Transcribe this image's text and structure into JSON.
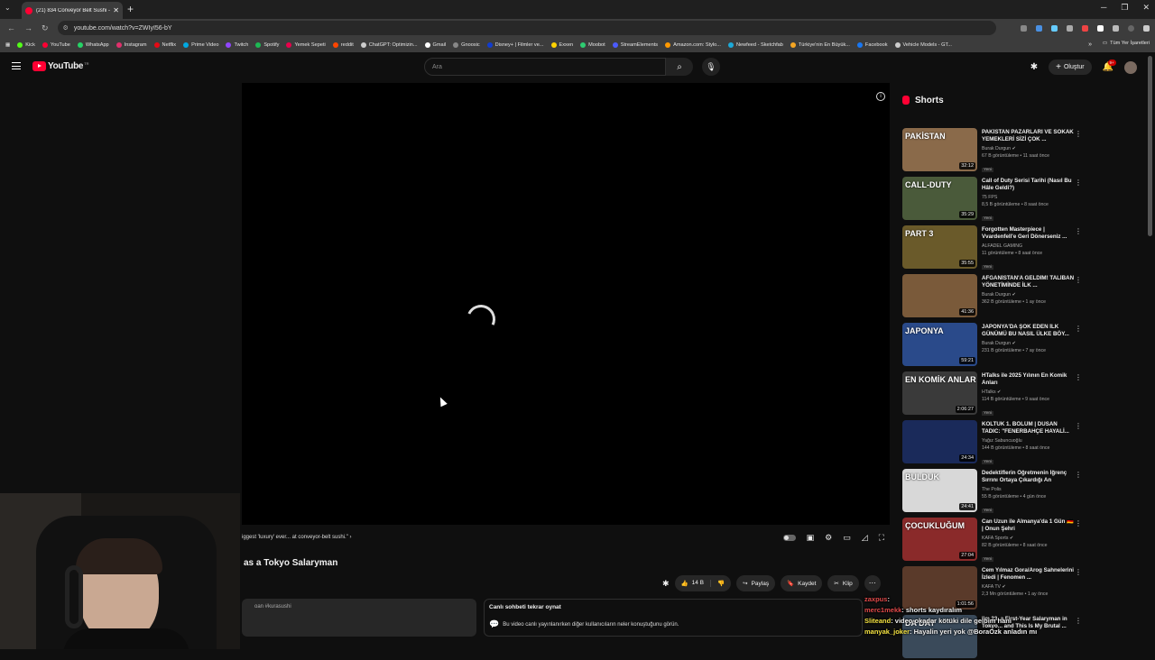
{
  "browser": {
    "tab_title": "(21) 834 Conveyor Belt Sushi -",
    "url": "youtube.com/watch?v=ZWIyI56-bY",
    "bookmarks": [
      {
        "label": "Kick",
        "color": "#53fc18"
      },
      {
        "label": "YouTube",
        "color": "#ff0033"
      },
      {
        "label": "WhatsApp",
        "color": "#25d366"
      },
      {
        "label": "Instagram",
        "color": "#e1306c"
      },
      {
        "label": "Netflix",
        "color": "#e50914"
      },
      {
        "label": "Prime Video",
        "color": "#00a8e1"
      },
      {
        "label": "Twitch",
        "color": "#9146ff"
      },
      {
        "label": "Spotify",
        "color": "#1db954"
      },
      {
        "label": "Yemek Sepeti",
        "color": "#ea004b"
      },
      {
        "label": "reddit",
        "color": "#ff4500"
      },
      {
        "label": "ChatGPT: Optimizin...",
        "color": "#cccccc"
      },
      {
        "label": "Gmail",
        "color": "#ffffff"
      },
      {
        "label": "Gnoosic",
        "color": "#888888"
      },
      {
        "label": "Disney+ | Filmler ve...",
        "color": "#113ccf"
      },
      {
        "label": "Exxen",
        "color": "#ffd200"
      },
      {
        "label": "Moobot",
        "color": "#2ecc71"
      },
      {
        "label": "StreamElements",
        "color": "#4b5bff"
      },
      {
        "label": "Amazon.com: Stylo...",
        "color": "#ff9900"
      },
      {
        "label": "Newfeed - Sketchfab",
        "color": "#1caad9"
      },
      {
        "label": "Türkiye'nin En Büyük...",
        "color": "#f5a623"
      },
      {
        "label": "Facebook",
        "color": "#1877f2"
      },
      {
        "label": "Vehicle Models - GT...",
        "color": "#cccccc"
      }
    ],
    "bookmarks_more": "»",
    "all_bookmarks": "Tüm Yer İşaretleri"
  },
  "youtube": {
    "logo_text": "YouTube",
    "country_code": "TR",
    "search_placeholder": "Ara",
    "create_label": "Oluştur",
    "notifications_count": "9+"
  },
  "player": {
    "chapter_title": "iggest 'luxury' ever... at conveyor-belt sushi.\"",
    "chapter_arrow": "›"
  },
  "video": {
    "title": "as a Tokyo Salaryman",
    "likes": "14 B",
    "share_label": "Paylaş",
    "save_label": "Kaydet",
    "clip_label": "Klip",
    "description_snippet": "oan #kurasushi"
  },
  "live_chat": {
    "header": "Canlı sohbeti tekrar oynat",
    "subtitle": "Bu video canlı yayınlanırken diğer kullanıcıların neler konuştuğunu görün."
  },
  "sidebar": {
    "shorts_label": "Shorts",
    "recommendations": [
      {
        "title": "PAKİSTAN PAZARLARI VE SOKAK YEMEKLERİ SİZİ ÇOK ...",
        "channel": "Burak Durgun",
        "verified": true,
        "meta": "67 B görüntüleme • 11 saat önce",
        "new": "Yeni",
        "duration": "32:12",
        "thumb_text": "PAKİSTAN",
        "thumb_color": "#8a6a4a"
      },
      {
        "title": "Call of Duty Serisi Tarihi (Nasıl Bu Hâle Geldi?)",
        "channel": "75 FPS",
        "verified": false,
        "meta": "8,5 B görüntüleme • 8 saat önce",
        "new": "Yeni",
        "duration": "35:29",
        "thumb_text": "CALL-DUTY",
        "thumb_color": "#4a5a3a"
      },
      {
        "title": "Forgotten Masterpiece | Vvardenfell'e Geri Dönerseniz ...",
        "channel": "ALFADEL GAMING",
        "verified": false,
        "meta": "11 görüntüleme • 8 saat önce",
        "new": "Yeni",
        "duration": "35:55",
        "thumb_text": "PART 3",
        "thumb_color": "#6a5a2a"
      },
      {
        "title": "AFGANİSTAN'A GELDİM! TALİBAN YÖNETİMİNDE İLK ...",
        "channel": "Burak Durgun",
        "verified": true,
        "meta": "362 B görüntüleme • 1 ay önce",
        "new": "",
        "duration": "41:36",
        "thumb_text": "",
        "thumb_color": "#7a5a3a"
      },
      {
        "title": "JAPONYA'DA ŞOK EDEN İLK GÜNÜMÜ BU NASIL ÜLKE BÖY...",
        "channel": "Burak Durgun",
        "verified": true,
        "meta": "231 B görüntüleme • 7 ay önce",
        "new": "",
        "duration": "59:21",
        "thumb_text": "JAPONYA",
        "thumb_color": "#2a4a8a"
      },
      {
        "title": "HTalks ile 2025 Yılının En Komik Anları",
        "channel": "HTalks",
        "verified": true,
        "meta": "114 B görüntüleme • 9 saat önce",
        "new": "Yeni",
        "duration": "2:06:27",
        "thumb_text": "EN KOMİK ANLAR",
        "thumb_color": "#3a3a3a"
      },
      {
        "title": "KOLTUK 1. BÖLÜM | DUSAN TADIC: \"FENERBAHÇE HAYALİ...",
        "channel": "Yağız Sabuncuoğlu",
        "verified": false,
        "meta": "144 B görüntüleme • 8 saat önce",
        "new": "Yeni",
        "duration": "24:34",
        "thumb_text": "",
        "thumb_color": "#1a2a5a"
      },
      {
        "title": "Dedektiflerin Öğretmenin İğrenç Sırrını Ortaya Çıkardığı An",
        "channel": "The Polis",
        "verified": false,
        "meta": "55 B görüntüleme • 4 gün önce",
        "new": "Yeni",
        "duration": "24:41",
        "thumb_text": "BULDUK",
        "thumb_color": "#d8d8d8"
      },
      {
        "title": "Can Uzun ile Almanya'da 1 Gün 🇩🇪 | Onun Şehri",
        "channel": "KAFA Sports",
        "verified": true,
        "meta": "82 B görüntüleme • 8 saat önce",
        "new": "Yeni",
        "duration": "27:04",
        "thumb_text": "ÇOCUKLUĞUM",
        "thumb_color": "#8a2a2a"
      },
      {
        "title": "Cem Yılmaz Gora/Arog Sahnelerini İzledi | Fenomen ...",
        "channel": "KAFA TV",
        "verified": true,
        "meta": "2,3 Mn görüntüleme • 1 ay önce",
        "new": "",
        "duration": "1:01:56",
        "thumb_text": "",
        "thumb_color": "#5a3a2a"
      },
      {
        "title": "I'm 23, a First-Year Salaryman in Tokyo... and This Is My Brutal ...",
        "channel": "",
        "verified": false,
        "meta": "",
        "new": "",
        "duration": "",
        "thumb_text": "DA DAY",
        "thumb_color": "#3a4a5a"
      }
    ]
  },
  "chat_overlay": [
    {
      "name": "zaxpus",
      "msg": ":",
      "name_color": "#e24a4a"
    },
    {
      "name": "merc1mekk",
      "msg": ": shorts kaydıralım",
      "name_color": "#e24a4a"
    },
    {
      "name": "Sliteand",
      "msg": ": video okadar kötüki dile gelbim hani",
      "name_color": "#f5e342"
    },
    {
      "name": "manyak_joker",
      "msg": ": Hayalin yeri yok @BoraOzk anladın mı",
      "name_color": "#f5e342"
    }
  ],
  "colors": {
    "accent": "#ff0033",
    "background": "#0f0f0f"
  }
}
